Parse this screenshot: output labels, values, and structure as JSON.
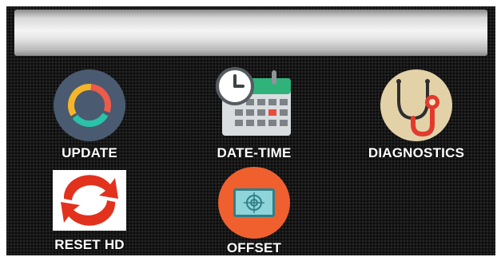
{
  "menu": {
    "items": [
      {
        "label": "UPDATE",
        "icon": "update-icon"
      },
      {
        "label": "DATE-TIME",
        "icon": "calendar-clock-icon"
      },
      {
        "label": "DIAGNOSTICS",
        "icon": "stethoscope-icon"
      },
      {
        "label": "RESET HD",
        "icon": "reset-arrows-icon"
      },
      {
        "label": "OFFSET",
        "icon": "target-screen-icon"
      }
    ]
  },
  "colors": {
    "background": "#161616",
    "update_bg": "#4a5a70",
    "diagnostics_bg": "#e3d2a8",
    "offset_bg": "#f0602e",
    "calendar_header": "#2fb37a",
    "reset_arrows": "#e2311d"
  }
}
